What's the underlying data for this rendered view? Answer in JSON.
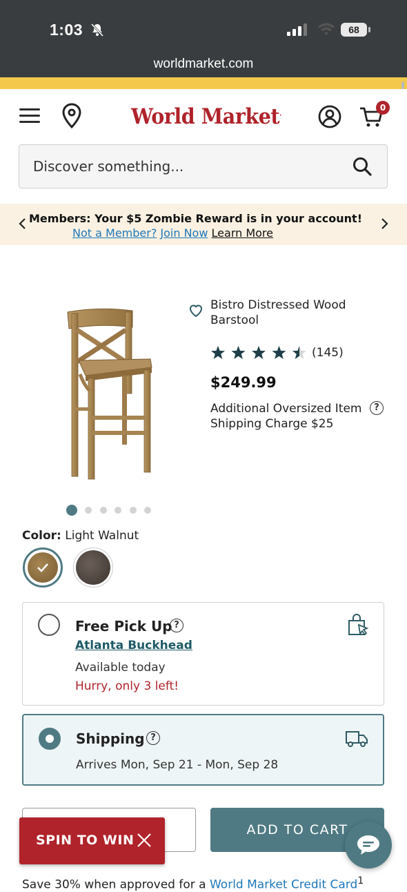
{
  "status_bar": {
    "time": "1:03",
    "battery": "68",
    "url": "worldmarket.com"
  },
  "header": {
    "logo": "World Market",
    "cart_count": "0"
  },
  "search": {
    "placeholder": "Discover something..."
  },
  "members_banner": {
    "headline": "Members: Your $5 Zombie Reward is in your account!",
    "not_member": "Not a Member?",
    "join_now": "Join Now",
    "learn_more": "Learn More"
  },
  "product": {
    "title": "Bistro Distressed Wood Barstool",
    "rating": 4.5,
    "review_count": "(145)",
    "price": "$249.99",
    "shipping_charge": "Additional Oversized Item Shipping Charge $25",
    "image_count": 6,
    "active_image": 1
  },
  "color": {
    "label": "Color:",
    "value": "Light Walnut"
  },
  "pickup": {
    "title": "Free Pick Up",
    "store": "Atlanta Buckhead",
    "availability": "Available today",
    "stock_warning": "Hurry, only 3 left!"
  },
  "shipping": {
    "title": "Shipping",
    "arrives": "Arrives Mon, Sep 21 - Mon, Sep 28"
  },
  "actions": {
    "add_to_cart": "ADD TO CART",
    "spin_to_win": "SPIN TO WIN"
  },
  "footer": {
    "text": "Save 30% when approved for a",
    "link": "World Market Credit Card",
    "sup": "1"
  },
  "colors": {
    "brand_red": "#b0232a",
    "teal": "#4f7a83",
    "promo_yellow": "#f4c84a"
  }
}
